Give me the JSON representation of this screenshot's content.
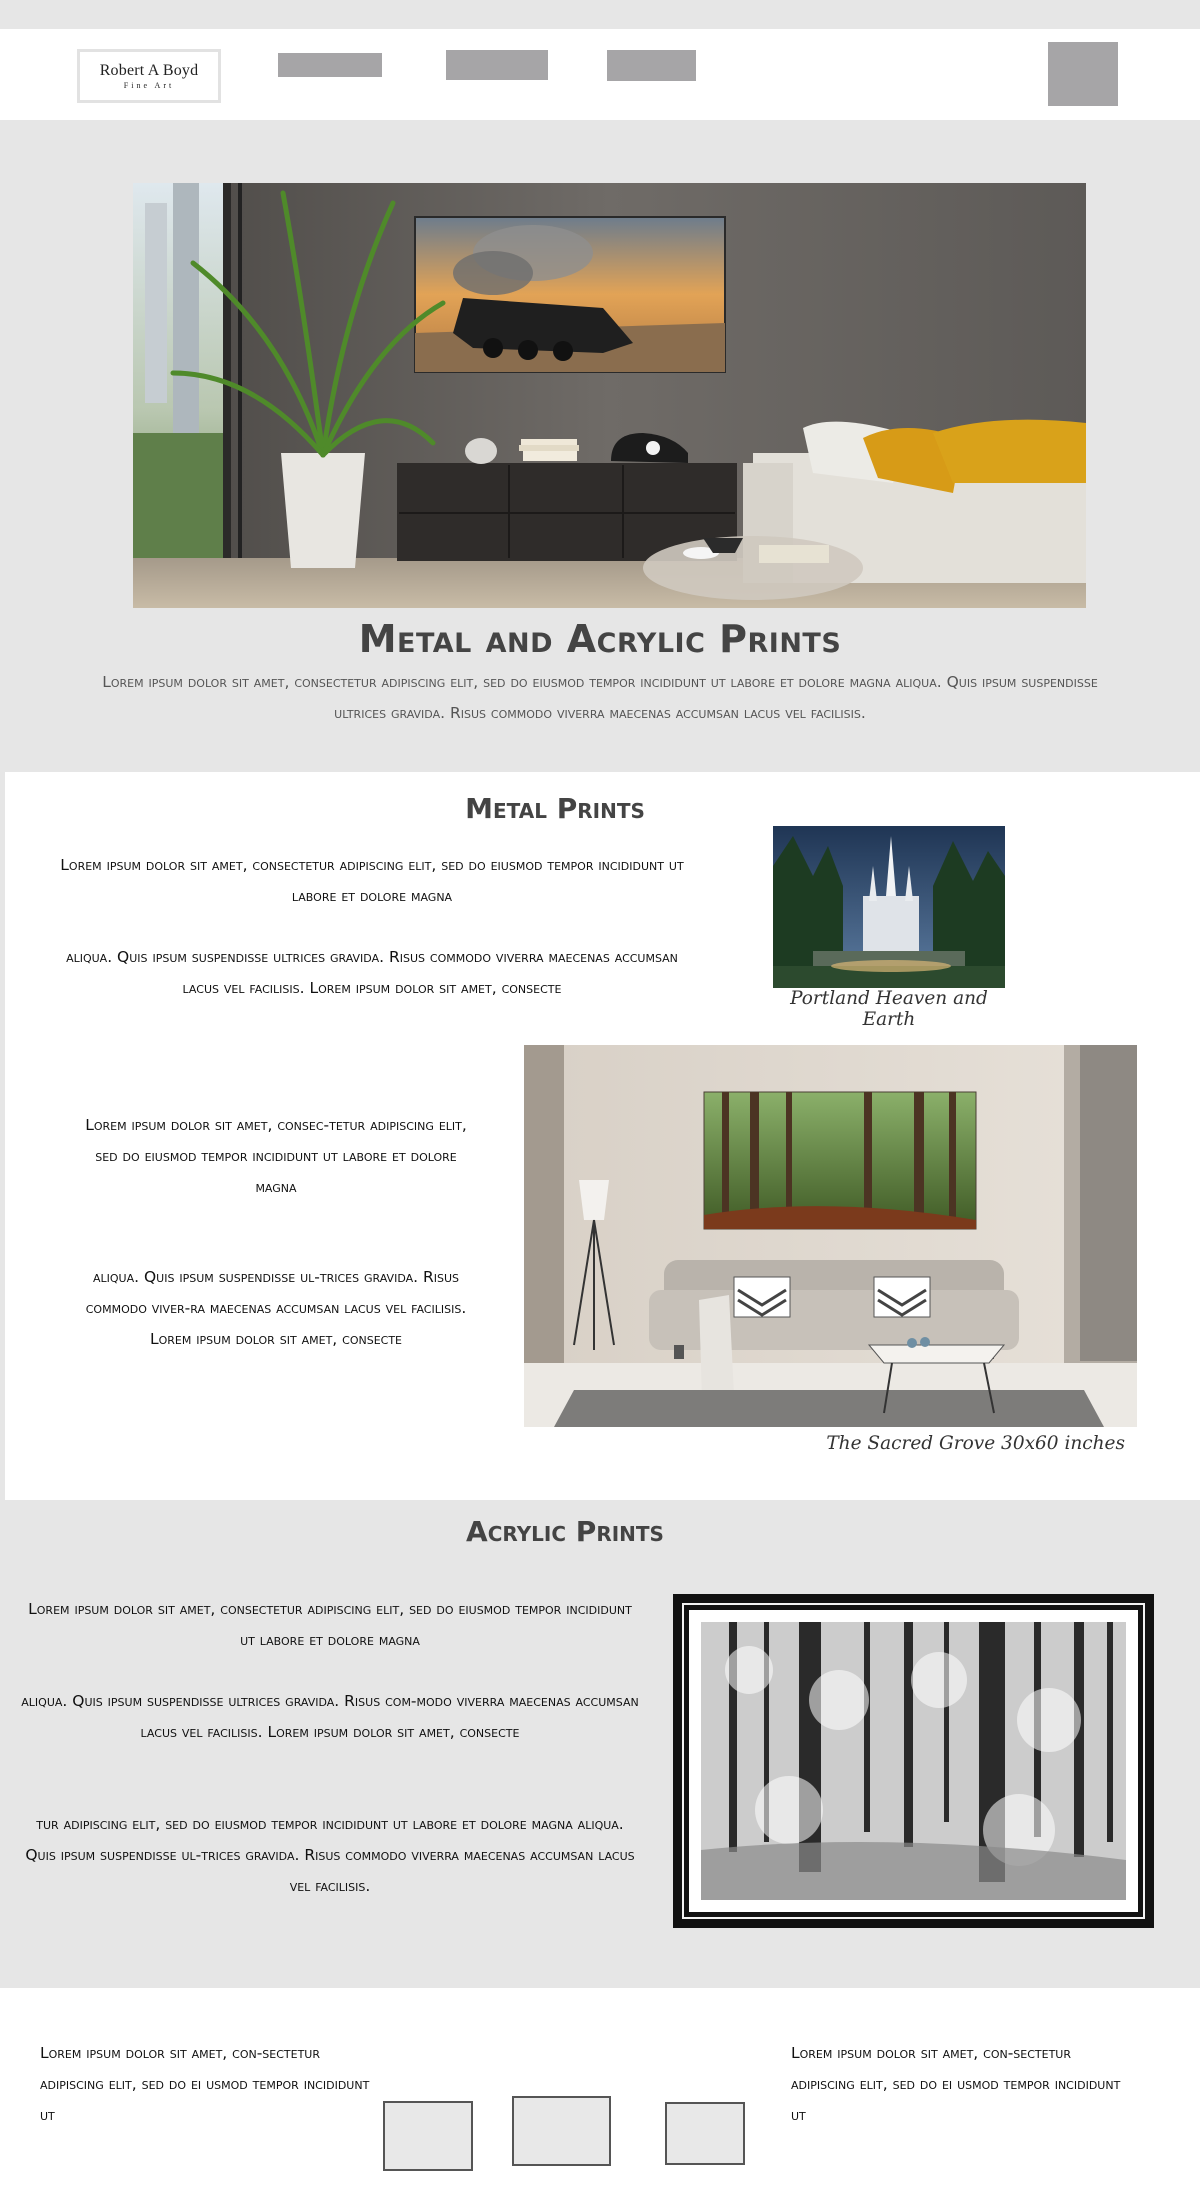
{
  "header": {
    "logo_line1": "Robert A Boyd",
    "logo_line2": "Fine Art"
  },
  "hero": {
    "title": "Metal and Acrylic Prints",
    "text": "Lorem ipsum dolor sit amet, consectetur adipiscing elit, sed do eiusmod tempor incididunt ut labore et dolore magna aliqua. Quis ipsum suspendisse ultrices gravida. Risus commodo viverra maecenas accumsan lacus vel facilisis."
  },
  "metal": {
    "title": "Metal Prints",
    "para1": "Lorem ipsum dolor sit amet, consectetur adipiscing elit, sed do eiusmod tempor incididunt ut labore et dolore magna",
    "para2": "aliqua. Quis ipsum suspendisse ultrices gravida. Risus commodo viverra maecenas accumsan lacus vel facilisis. Lorem ipsum dolor sit amet, consecte",
    "caption1": "Portland Heaven and Earth",
    "para3": "Lorem ipsum dolor sit amet, consec-tetur adipiscing elit, sed do eiusmod tempor incididunt ut labore et dolore magna",
    "para4": "aliqua. Quis ipsum suspendisse ul-trices gravida. Risus commodo viver-ra maecenas accumsan lacus vel facilisis. Lorem ipsum dolor sit amet, consecte",
    "caption2": "The Sacred Grove 30x60 inches"
  },
  "acrylic": {
    "title": "Acrylic Prints",
    "para1": "Lorem ipsum dolor sit amet, consectetur adipiscing elit, sed do eiusmod tempor incididunt ut labore et dolore magna",
    "para2": "aliqua. Quis ipsum suspendisse ultrices gravida. Risus com-modo viverra maecenas accumsan lacus vel facilisis. Lorem ipsum dolor sit amet, consecte",
    "para3": "tur adipiscing elit, sed do eiusmod tempor incididunt ut labore et dolore magna aliqua. Quis ipsum suspendisse ul-trices gravida. Risus commodo viverra maecenas accumsan lacus vel facilisis."
  },
  "footer": {
    "left_text": "Lorem ipsum dolor sit amet, con-sectetur adipiscing elit, sed do ei usmod tempor incididunt ut",
    "right_text": "Lorem ipsum dolor sit amet, con-sectetur adipiscing elit, sed do ei usmod tempor incididunt ut"
  }
}
